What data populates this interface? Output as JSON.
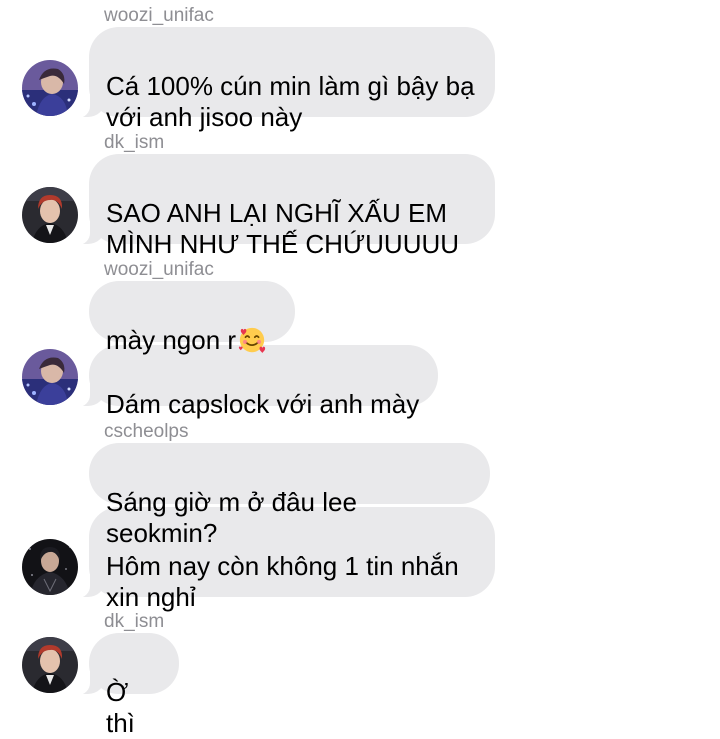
{
  "messages": [
    {
      "sender": "woozi_unifac",
      "text": "Cá 100% cún min làm gì bậy bạ\nvới anh jisoo này"
    },
    {
      "sender": "dk_ism",
      "text": "SAO ANH LẠI NGHĨ XẤU EM\nMÌNH NHƯ THẾ CHỨUUUUU"
    },
    {
      "sender": "woozi_unifac",
      "text": "mày ngon r",
      "emoji": "smiling-face-with-hearts-icon"
    },
    {
      "sender": "",
      "text": "Dám capslock với anh mày"
    },
    {
      "sender": "cscheolps",
      "text": "Sáng giờ m ở đâu lee seokmin?"
    },
    {
      "sender": "",
      "text": "Hôm nay còn không 1 tin nhắn\nxin nghỉ"
    },
    {
      "sender": "dk_ism",
      "text": "Ờ thì"
    }
  ],
  "colors": {
    "bubble": "#e9e9eb",
    "sender_name": "#8e8e93",
    "text": "#000000",
    "background": "#ffffff"
  }
}
